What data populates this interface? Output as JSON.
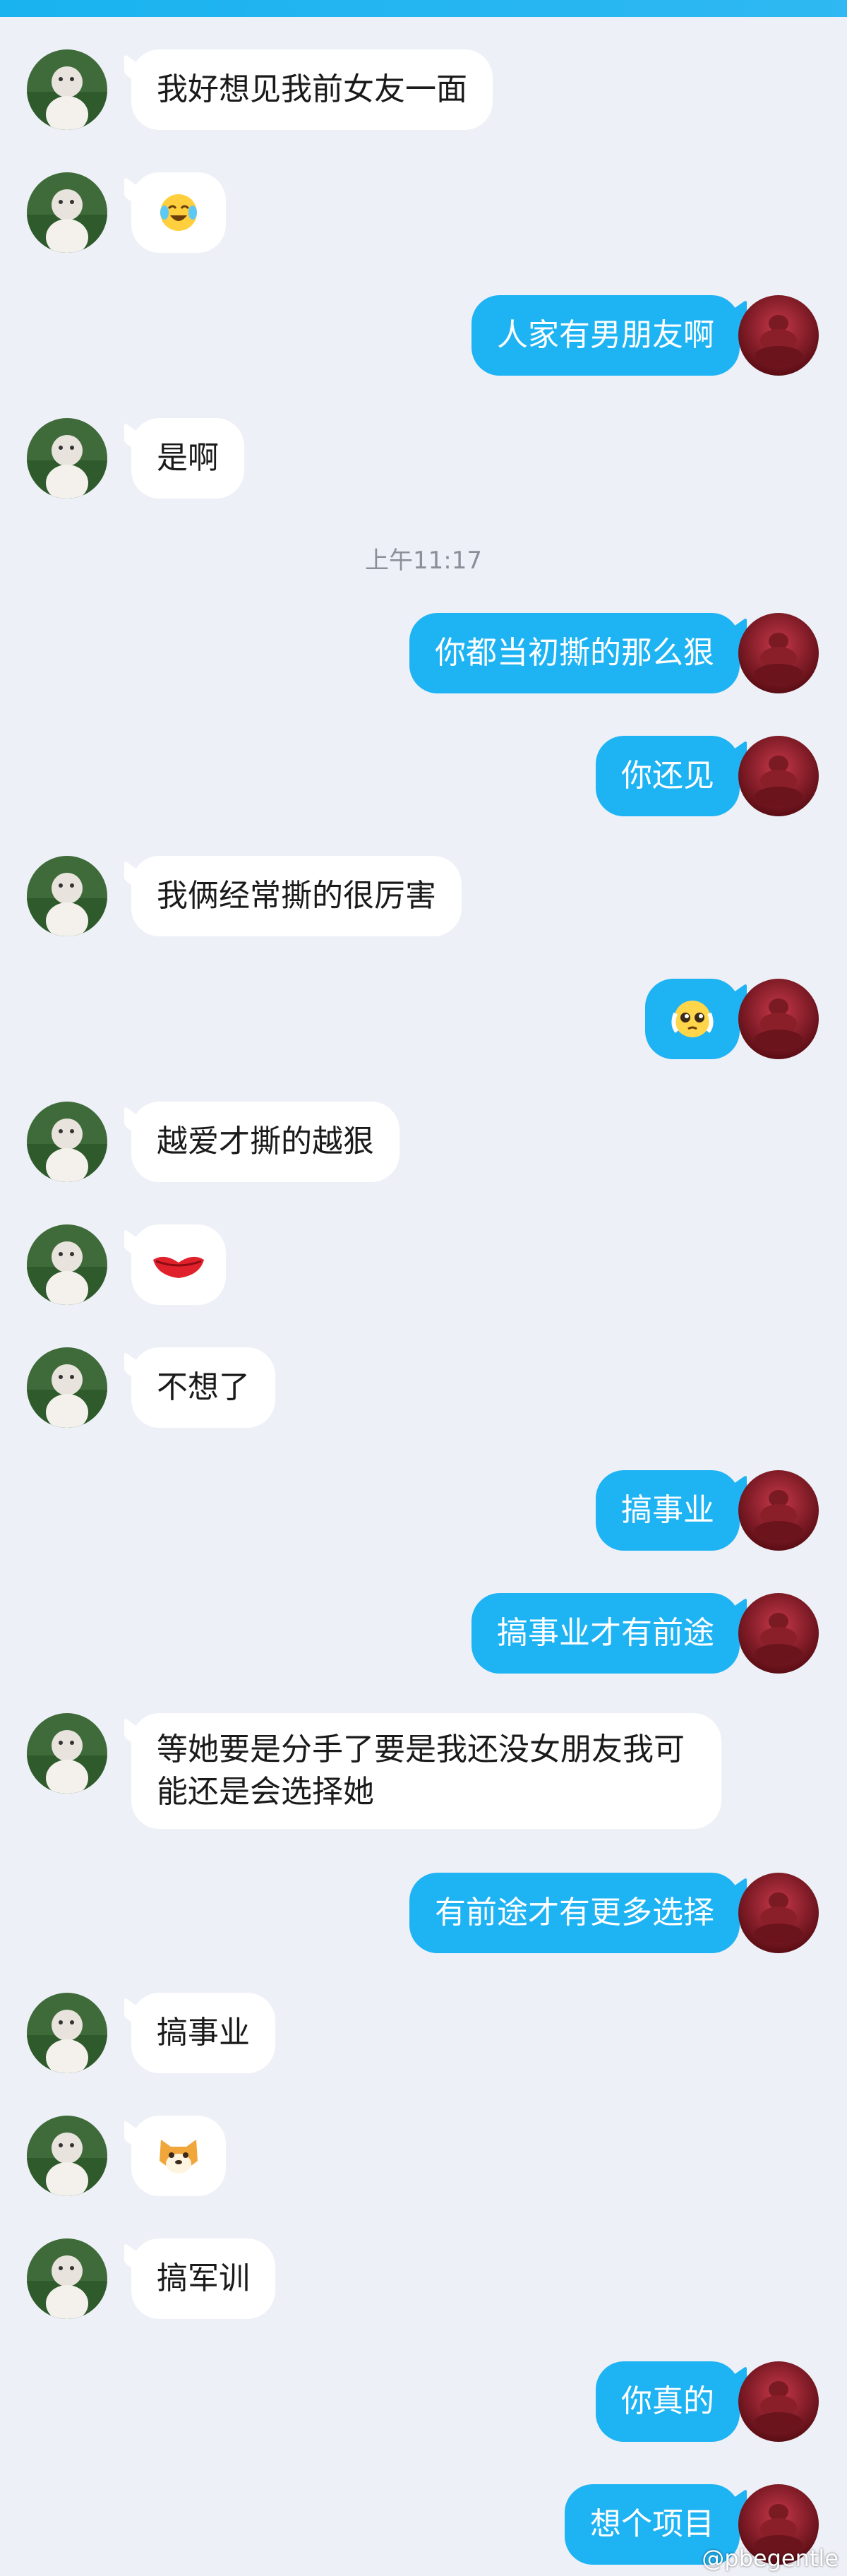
{
  "messages": [
    {
      "side": "left",
      "text": "我好想见我前女友一面"
    },
    {
      "side": "left",
      "sticker": "crying-laughing-emoji"
    },
    {
      "side": "right",
      "text": "人家有男朋友啊"
    },
    {
      "side": "left",
      "text": "是啊"
    },
    {
      "side": "right",
      "text": "你都当初撕的那么狠"
    },
    {
      "side": "right",
      "text": "你还见"
    },
    {
      "side": "left",
      "text": "我俩经常撕的很厉害"
    },
    {
      "side": "right",
      "sticker": "pleading-face-emoji"
    },
    {
      "side": "left",
      "text": "越爱才撕的越狠"
    },
    {
      "side": "left",
      "sticker": "red-lips-emoji"
    },
    {
      "side": "left",
      "text": "不想了"
    },
    {
      "side": "right",
      "text": "搞事业"
    },
    {
      "side": "right",
      "text": "搞事业才有前途"
    },
    {
      "side": "left",
      "text": "等她要是分手了要是我还没女朋友我可能还是会选择她"
    },
    {
      "side": "right",
      "text": "有前途才有更多选择"
    },
    {
      "side": "left",
      "text": "搞事业"
    },
    {
      "side": "left",
      "sticker": "shiba-dog-emoji"
    },
    {
      "side": "left",
      "text": "搞军训"
    },
    {
      "side": "right",
      "text": "你真的"
    },
    {
      "side": "right",
      "text": "想个项目"
    }
  ],
  "timestamp": "上午11:17",
  "watermark": "@pbegentle",
  "colors": {
    "background": "#eef0f7",
    "outgoing_bubble": "#1eb3f3",
    "incoming_bubble": "#ffffff",
    "timestamp": "#8a8f99"
  }
}
